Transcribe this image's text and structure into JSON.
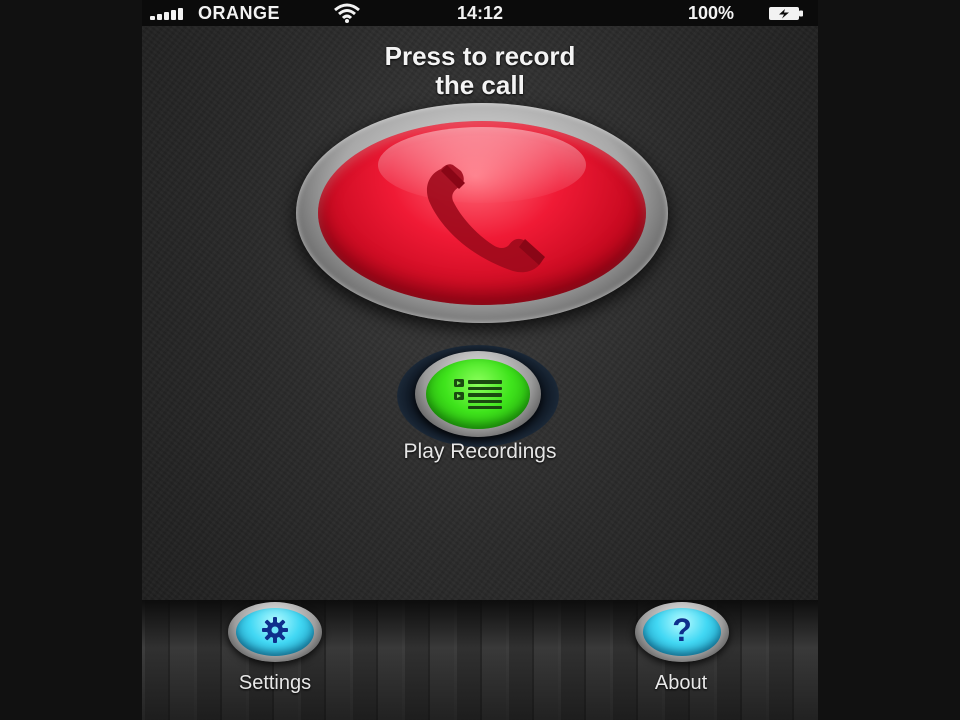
{
  "status_bar": {
    "carrier": "ORANGE",
    "time": "14:12",
    "battery_percent": "100%",
    "icons": [
      "signal-bars-icon",
      "wifi-icon",
      "battery-charging-icon"
    ]
  },
  "main": {
    "heading_line1": "Press to record",
    "heading_line2": "the call",
    "record_button_icon": "phone-handset-icon",
    "record_button_color": "#e01028",
    "play_recordings": {
      "label": "Play Recordings",
      "icon": "list-icon",
      "color": "#3fe41c"
    }
  },
  "bottom_bar": {
    "settings": {
      "label": "Settings",
      "icon": "gear-icon",
      "color": "#42d8f4"
    },
    "about": {
      "label": "About",
      "icon": "question-mark-icon",
      "glyph": "?",
      "color": "#42d8f4"
    }
  }
}
